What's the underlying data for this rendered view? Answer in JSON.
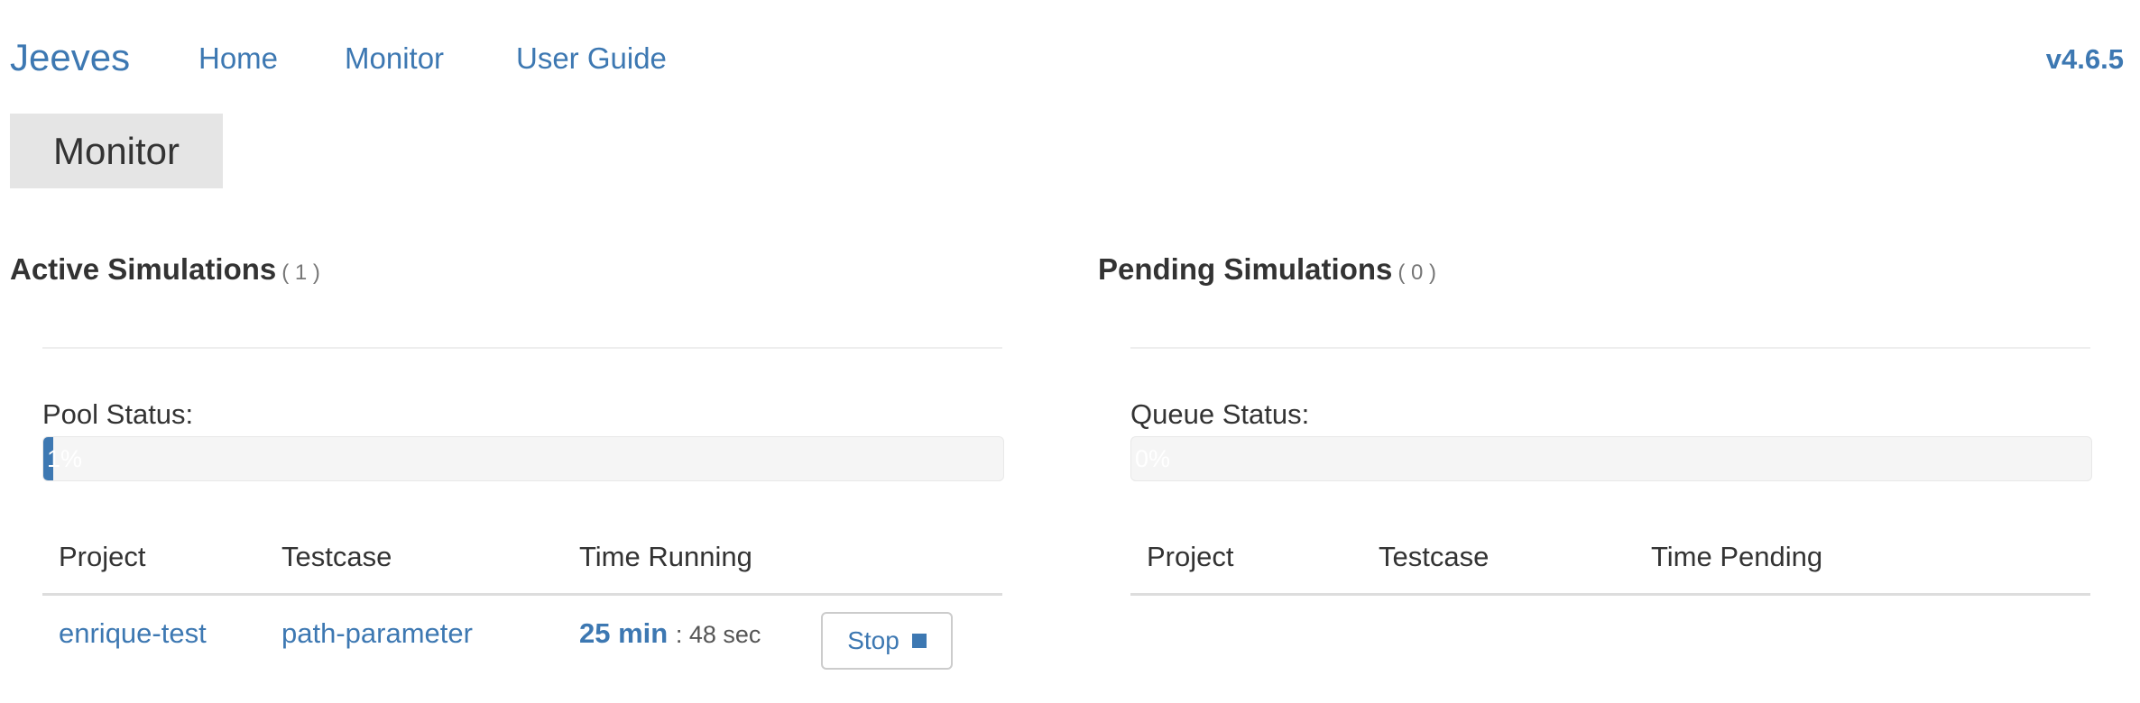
{
  "nav": {
    "brand": "Jeeves",
    "links": [
      "Home",
      "Monitor",
      "User Guide"
    ],
    "version": "v4.6.5"
  },
  "page": {
    "badge": "Monitor"
  },
  "active": {
    "title": "Active Simulations",
    "count": "( 1 )",
    "status_label": "Pool Status:",
    "progress": {
      "value": 1,
      "text": "1%"
    },
    "columns": [
      "Project",
      "Testcase",
      "Time Running"
    ],
    "rows": [
      {
        "project": "enrique-test",
        "testcase": "path-parameter",
        "time_min": "25 min",
        "time_sec": ": 48 sec",
        "stop_label": "Stop"
      }
    ]
  },
  "pending": {
    "title": "Pending Simulations",
    "count": "( 0 )",
    "status_label": "Queue Status:",
    "progress": {
      "value": 0,
      "text": "0%"
    },
    "columns": [
      "Project",
      "Testcase",
      "Time Pending"
    ]
  },
  "colors": {
    "accent": "#3d78b2",
    "badge_bg": "#e5e5e5",
    "progress_bg": "#f5f5f5"
  },
  "icons": {
    "stop": "stop-square-icon"
  }
}
